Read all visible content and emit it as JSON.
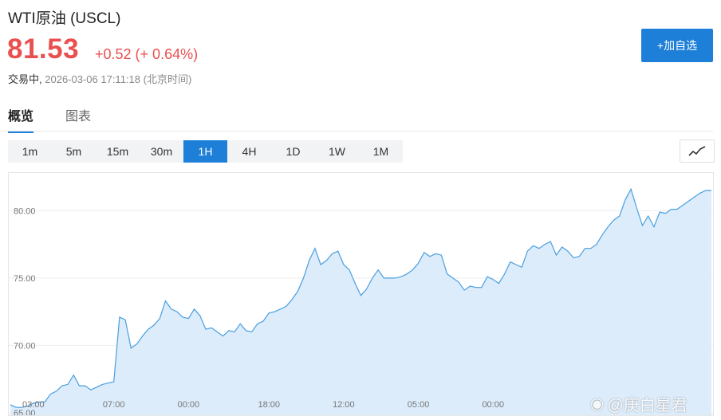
{
  "header": {
    "title": "WTI原油 (USCL)",
    "price": "81.53",
    "change": "+0.52 (+ 0.64%)",
    "status_label": "交易中,",
    "timestamp": "2026-03-06 17:11:18 (北京时间)"
  },
  "actions": {
    "add_watchlist": "+加自选"
  },
  "tabs": [
    {
      "label": "概览",
      "active": true
    },
    {
      "label": "图表",
      "active": false
    }
  ],
  "intervals": [
    {
      "label": "1m",
      "active": false
    },
    {
      "label": "5m",
      "active": false
    },
    {
      "label": "15m",
      "active": false
    },
    {
      "label": "30m",
      "active": false
    },
    {
      "label": "1H",
      "active": true
    },
    {
      "label": "4H",
      "active": false
    },
    {
      "label": "1D",
      "active": false
    },
    {
      "label": "1W",
      "active": false
    },
    {
      "label": "1M",
      "active": false
    }
  ],
  "chart_type_icon": "line-chart-icon",
  "colors": {
    "up": "#e94f4f",
    "accent": "#1e7fd8",
    "line": "#4a9fde",
    "area": "#dcecfb"
  },
  "watermark": "@庚白星君",
  "chart_data": {
    "type": "area",
    "xlabel": "",
    "ylabel": "",
    "ylim": [
      64.7,
      82.8
    ],
    "yticks": [
      "65.00",
      "70.00",
      "75.00",
      "80.00"
    ],
    "xticks": [
      "03:00",
      "07:00",
      "00:00",
      "18:00",
      "12:00",
      "05:00",
      "00:00"
    ],
    "x_tick_index": [
      4,
      18,
      31,
      45,
      58,
      71,
      84
    ],
    "values": [
      65.6,
      65.4,
      65.4,
      65.5,
      65.7,
      65.8,
      65.8,
      66.4,
      66.6,
      67.0,
      67.1,
      67.8,
      67.0,
      67.0,
      66.7,
      66.9,
      67.1,
      67.2,
      67.3,
      72.1,
      71.9,
      69.8,
      70.1,
      70.7,
      71.2,
      71.5,
      72.0,
      73.3,
      72.7,
      72.5,
      72.1,
      72.0,
      72.7,
      72.2,
      71.2,
      71.3,
      71.0,
      70.7,
      71.1,
      71.0,
      71.6,
      71.1,
      71.0,
      71.6,
      71.8,
      72.4,
      72.5,
      72.7,
      72.9,
      73.4,
      74.0,
      75.0,
      76.3,
      77.2,
      76.0,
      76.3,
      76.8,
      77.0,
      76.0,
      75.6,
      74.6,
      73.7,
      74.2,
      75.0,
      75.6,
      75.0,
      75.0,
      75.0,
      75.1,
      75.3,
      75.6,
      76.1,
      76.9,
      76.6,
      76.8,
      76.7,
      75.3,
      75.0,
      74.7,
      74.1,
      74.4,
      74.3,
      74.3,
      75.1,
      74.9,
      74.6,
      75.3,
      76.2,
      76.0,
      75.8,
      77.0,
      77.4,
      77.2,
      77.5,
      77.7,
      76.7,
      77.3,
      77.0,
      76.5,
      76.6,
      77.2,
      77.2,
      77.5,
      78.2,
      78.8,
      79.3,
      79.6,
      80.8,
      81.6,
      80.2,
      78.9,
      79.6,
      78.8,
      79.9,
      79.8,
      80.1,
      80.1,
      80.4,
      80.7,
      81.0,
      81.3,
      81.5,
      81.5
    ]
  }
}
